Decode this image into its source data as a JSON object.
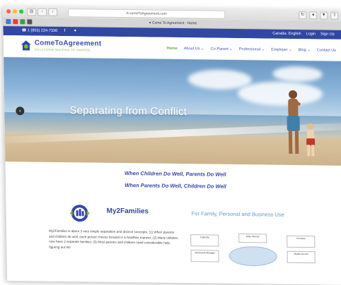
{
  "browser": {
    "url": "A comeToAgreement.com",
    "tab_title": "Come To Agreement - Home"
  },
  "topbar": {
    "phone": "☎ 1 (855) 224-7330",
    "social": "f  ✦",
    "language": "Canada: English",
    "login": "Login",
    "signup": "Sign Up"
  },
  "logo": {
    "name": "ComeToAgreement",
    "tagline": "SOLUTIONS WAITING TO HAPPEN"
  },
  "nav": {
    "items": [
      "Home",
      "About Us ⌄",
      "Co-Parent ⌄",
      "Professional ⌄",
      "Employer ⌄",
      "Blog ⌄",
      "Contact Us"
    ]
  },
  "hero": {
    "title": "Separating from Conflict",
    "prev_icon": "‹"
  },
  "tagline": {
    "line1": "When Children Do Well, Parents Do Well",
    "line2": "When Parents Do Well, Children Do Well"
  },
  "my2families": {
    "name": "My2Families",
    "subtitle": "For Family, Personal and Business Use",
    "body": "My2Families is about 3 very simple separation and divorce concepts. (1) When parents and children do well, each person moves forward in a healthier manner; (2) Many children now have 2 separate families; (3) Most parents and children need considerable help figuring out the"
  },
  "diagram": {
    "boxes": [
      "Calendar",
      "Daily Planner",
      "Contacts",
      "Homework Manager",
      "Media Central"
    ]
  },
  "colors": {
    "brand_blue": "#3047a3",
    "accent_green": "#6aa63a"
  }
}
